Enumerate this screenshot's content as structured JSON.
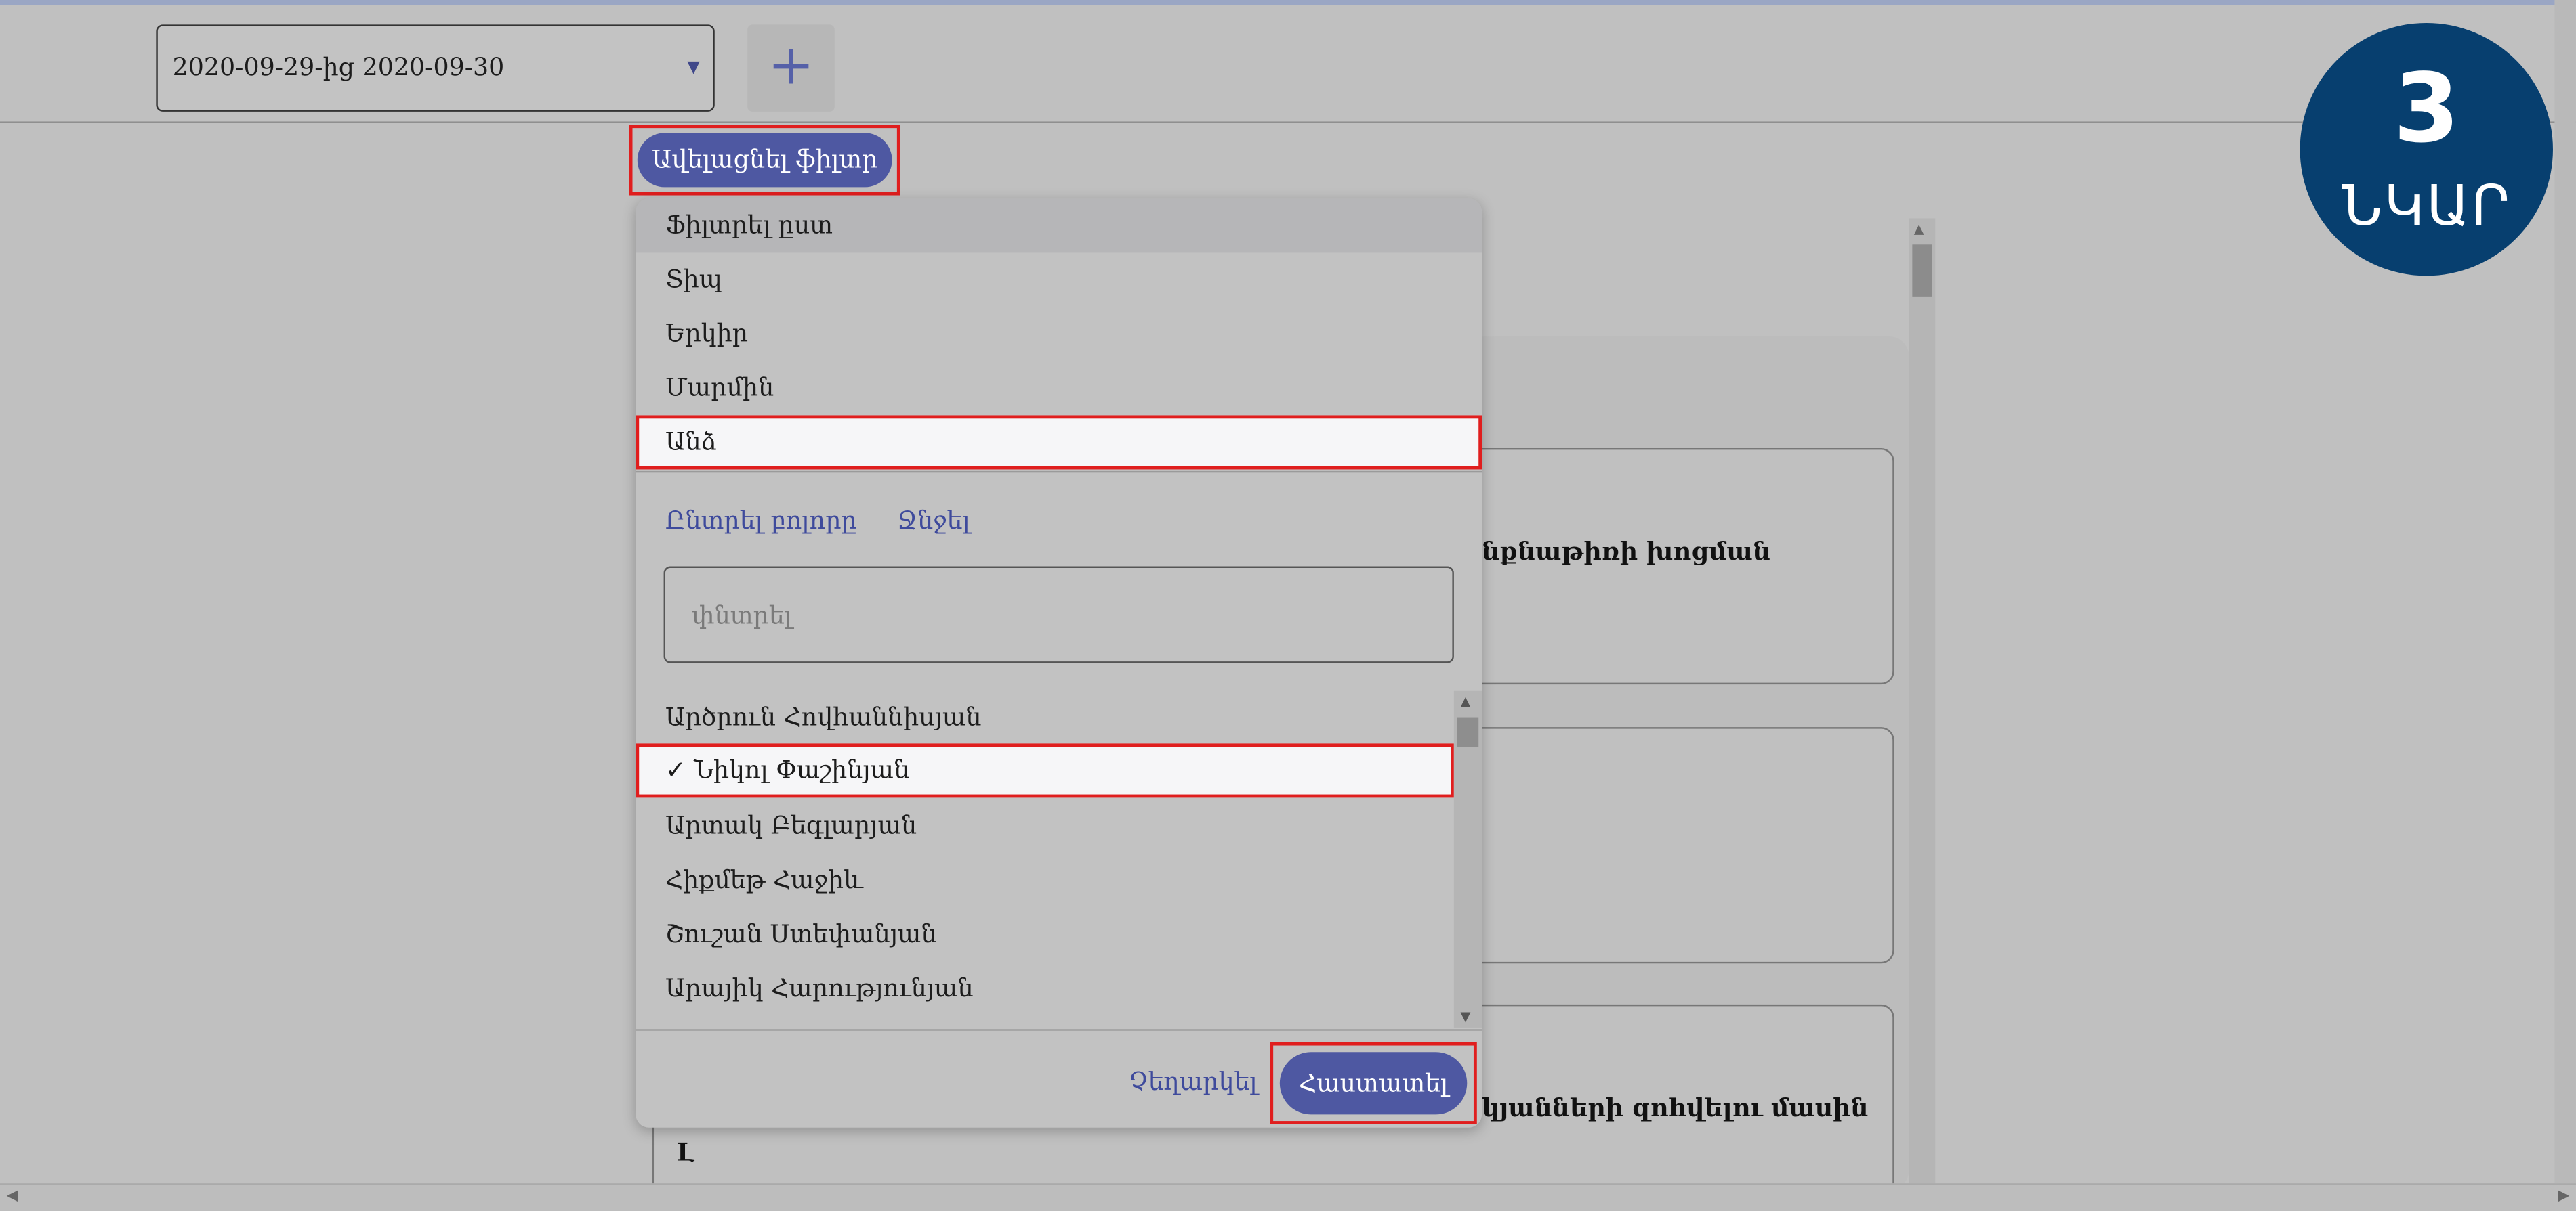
{
  "header": {
    "date_range": "2020-09-29-ից 2020-09-30",
    "add_icon": "plus-icon"
  },
  "add_filter_label": "Ավելացնել ֆիլտր",
  "filter_menu": {
    "title": "Ֆիլտրել ըստ",
    "options": [
      "Տիպ",
      "Երկիր",
      "Մարմին",
      "Անձ"
    ],
    "selected_option": "Անձ",
    "select_all_label": "Ընտրել բոլորը",
    "clear_label": "Ջնջել",
    "search_placeholder": "փնտրել",
    "people": [
      {
        "name": "Արծրուն Հովհաննիսյան",
        "checked": false
      },
      {
        "name": "Նիկոլ Փաշինյան",
        "checked": true,
        "check_mark": "✓"
      },
      {
        "name": "Արտակ Բեգլարյան",
        "checked": false
      },
      {
        "name": "Հիքմեթ Հաջիև",
        "checked": false
      },
      {
        "name": "Շուշան Ստեփանյան",
        "checked": false
      },
      {
        "name": "Արայիկ Հարությունյան",
        "checked": false
      }
    ],
    "cancel_label": "Չեղարկել",
    "confirm_label": "Հաստատել"
  },
  "background": {
    "card1_text": "նքնաթիռի խոցման",
    "card3_text": "կյանների զոհվելու մասին",
    "card3_cut_text": "Լ"
  },
  "badge": {
    "number": "3",
    "word": "ՆԿԱՐ",
    "color": "#073f6f"
  },
  "accent_color": "#4e58a2",
  "highlight_color": "#e01e1e"
}
